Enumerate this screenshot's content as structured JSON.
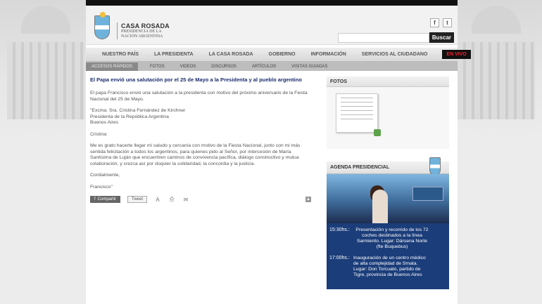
{
  "header": {
    "title": "CASA ROSADA",
    "subtitle_line1": "PRESIDENCIA DE LA",
    "subtitle_line2": "NACIÓN ARGENTINA",
    "facebook_label": "f",
    "twitter_label": "t",
    "search_placeholder": "",
    "search_button": "Buscar"
  },
  "nav": {
    "items": [
      "NUESTRO PAÍS",
      "LA PRESIDENTA",
      "LA CASA ROSADA",
      "GOBIERNO",
      "INFORMACIÓN",
      "SERVICIOS AL CIUDADANO"
    ],
    "live": "EN VIVO"
  },
  "subnav": {
    "quick_access": "ACCESOS RÁPIDOS",
    "items": [
      "FOTOS",
      "VIDEOS",
      "DISCURSOS",
      "ARTÍCULOS",
      "VISITAS GUIADAS"
    ]
  },
  "article": {
    "title": "El Papa envió una salutación por el 25 de Mayo a la Presidenta y al pueblo argentino",
    "p1": "El papa Francisco envió una salutación a la presidenta con motivo del próximo aniversario de la Fiesta Nacional del 25 de Mayo.",
    "p2_line1": "\"Excma. Sra. Cristina Fernández de Kirchner",
    "p2_line2": "Presidenta de la República Argentina",
    "p2_line3": "Buenos Aires",
    "p3": "Cristina:",
    "p4": "Me es grato hacerte llegar mi saludo y cercanía con motivo de la Fiesta Nacional, junto con mi más sentida felicitación a todos los argentinos, para quienes pido al Señor, por intercesión de María Santísima de Luján que encuentren caminos de convivencia pacífica, diálogo constructivo y mutua colaboración, y crezca así por doquier la solidaridad, la concordia y la justicia.",
    "p5": "Cordialmente,",
    "p6": "Francisco\"",
    "share_fb": "Compartir",
    "share_tw": "Tweet"
  },
  "sidebar": {
    "photos_title": "FOTOS",
    "agenda_title": "AGENDA PRESIDENCIAL",
    "agenda": [
      {
        "time": "15:30hs.:",
        "desc": "Presentación y recorrido de los 72 coches destinados a la línea Sarmiento. Lugar: Dársena Norte (fte Buquebus)"
      },
      {
        "time": "17:00hs.:",
        "desc": "Inauguración de un centro médico de alta complejidad de Smata. Lugar: Don Torcuato, partido de Tigre, provincia de Buenos Aires"
      }
    ]
  }
}
